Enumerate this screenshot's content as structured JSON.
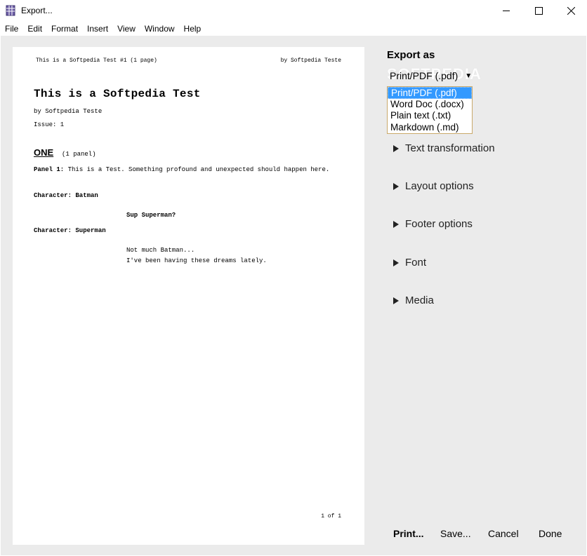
{
  "window": {
    "title": "Export..."
  },
  "menu": [
    "File",
    "Edit",
    "Format",
    "Insert",
    "View",
    "Window",
    "Help"
  ],
  "preview": {
    "header_left": "This is a Softpedia Test #1 (1 page)",
    "header_right": "by Softpedia Teste",
    "title": "This is a Softpedia Test",
    "byline": "by Softpedia Teste",
    "issue": "Issue: 1",
    "section_title": "ONE",
    "section_note": "(1 panel)",
    "panel_label": "Panel 1:",
    "panel_text": "This is a Test. Something profound and unexpected should happen here.",
    "char1": "Character: Batman",
    "dialog1": "Sup Superman?",
    "char2": "Character: Superman",
    "dialog2_line1": "Not much Batman...",
    "dialog2_line2": "I've been having these dreams lately.",
    "footer": "1 of 1"
  },
  "export": {
    "label": "Export as",
    "current": "Print/PDF (.pdf)",
    "arrow_icon": "triangle-down",
    "watermark": "SOFTPEDIA",
    "options": [
      "Print/PDF (.pdf)",
      "Word Doc (.docx)",
      "Plain text (.txt)",
      "Markdown (.md)"
    ],
    "selected_index": 0
  },
  "sections": [
    "Text transformation",
    "Layout options",
    "Footer options",
    "Font",
    "Media"
  ],
  "buttons": {
    "print": "Print...",
    "save": "Save...",
    "cancel": "Cancel",
    "done": "Done"
  },
  "colors": {
    "selection": "#3399ff",
    "panel_bg": "#ebebeb",
    "dropdown_border": "#c9a96a"
  }
}
